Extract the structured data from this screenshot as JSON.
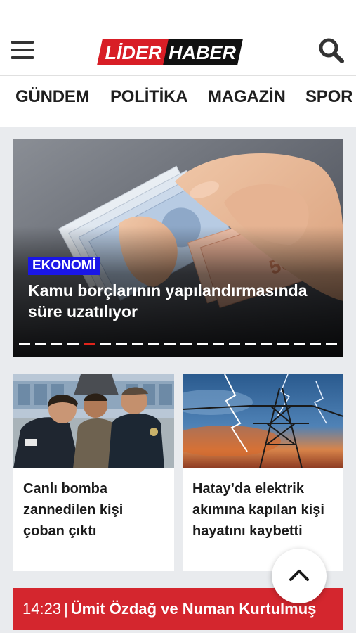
{
  "header": {
    "logo": {
      "part1": "LİDER",
      "part2": "HABER"
    },
    "menu_icon": "hamburger-menu-icon",
    "search_icon": "search-icon"
  },
  "nav": {
    "items": [
      "GÜNDEM",
      "POLİTİKA",
      "MAGAZİN",
      "SPOR"
    ]
  },
  "hero": {
    "category": "EKONOMİ",
    "title": "Kamu borçlarının yapılandırmasında süre uzatılıyor",
    "slides_total": 20,
    "active_slide": 5
  },
  "cards": [
    {
      "title": "Canlı bomba zannedilen kişi çoban çıktı"
    },
    {
      "title": "Hatay’da elektrik akımına kapılan kişi hayatını kaybetti"
    }
  ],
  "breaking": {
    "time": "14:23",
    "separator": "|",
    "headline": "Ümit Özdağ ve Numan Kurtulmuş"
  },
  "colors": {
    "logo_red": "#d81e26",
    "logo_black": "#111111",
    "category_badge": "#1a16e8",
    "breaking_bar": "#d4262e",
    "active_dot": "#e0241b"
  }
}
